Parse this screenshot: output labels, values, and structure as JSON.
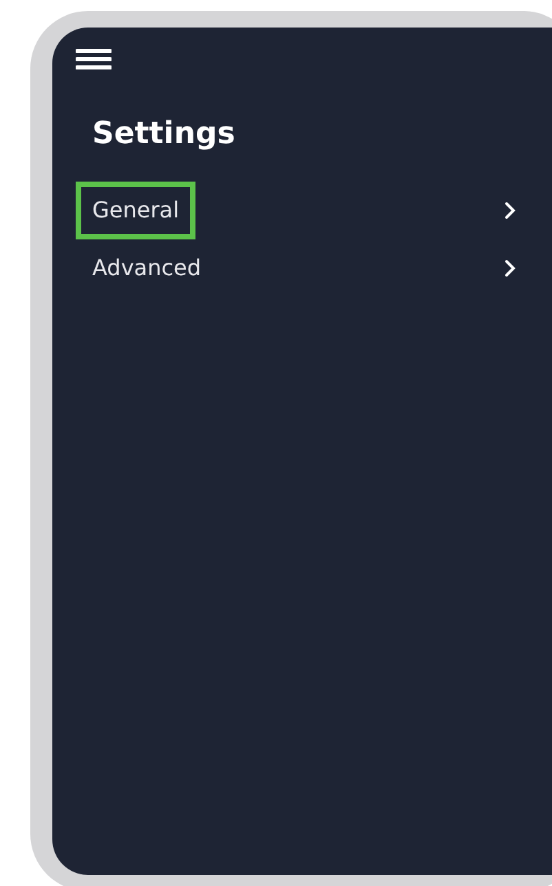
{
  "title": "Settings",
  "items": [
    {
      "label": "General",
      "selected": true
    },
    {
      "label": "Advanced",
      "selected": false
    }
  ]
}
